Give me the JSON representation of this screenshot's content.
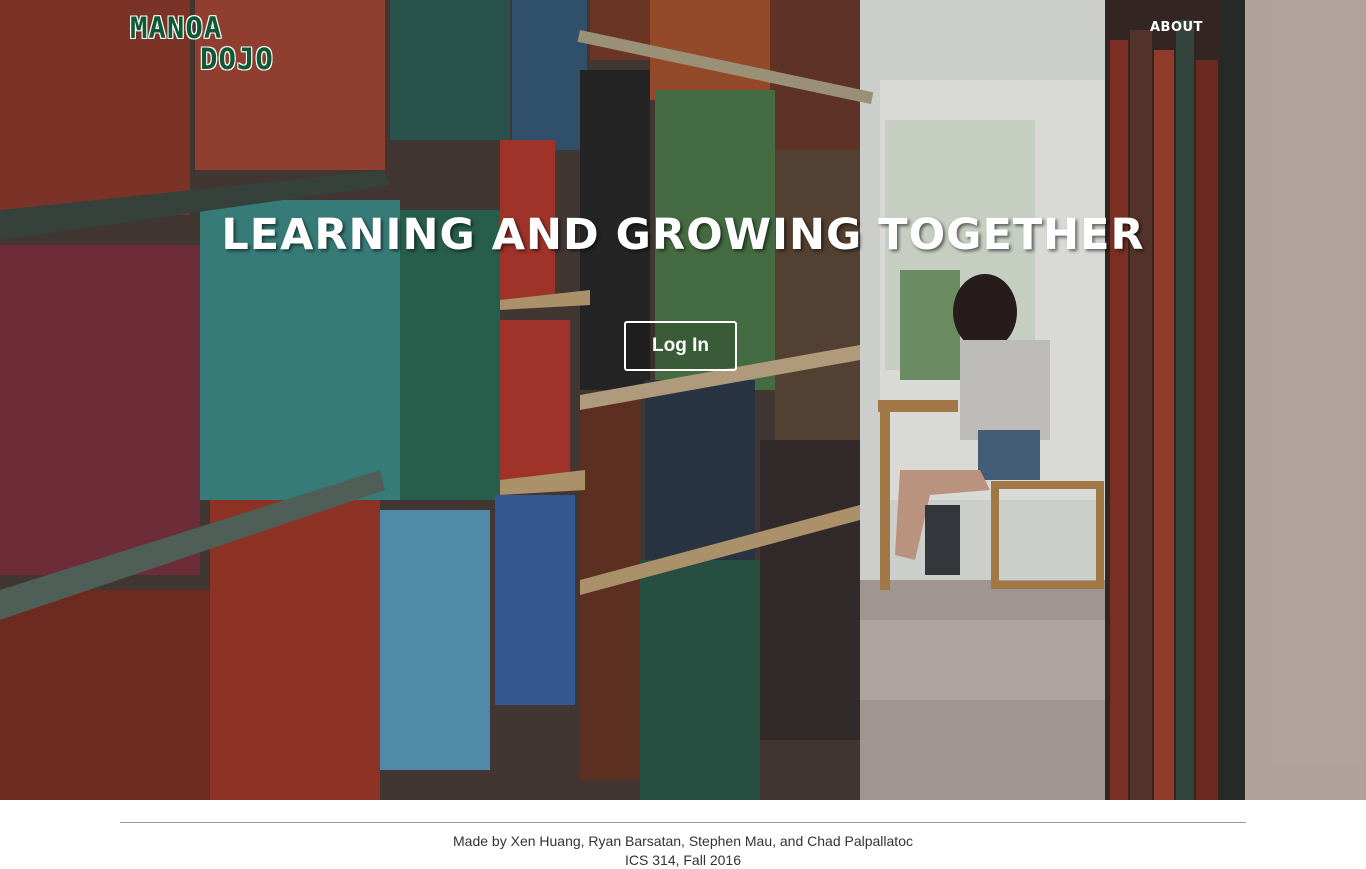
{
  "nav": {
    "logo_line1": "MANOA",
    "logo_line2": "DOJO",
    "about_label": "ABOUT"
  },
  "hero": {
    "headline": "LEARNING AND GROWING TOGETHER",
    "login_label": "Log In"
  },
  "footer": {
    "credits": "Made by Xen Huang, Ryan Barsatan, Stephen Mau, and Chad Palpallatoc",
    "course": "ICS 314, Fall 2016"
  },
  "colors": {
    "brand_green": "#0f5a35",
    "hero_text": "#ffffff",
    "footer_text": "#333333"
  }
}
